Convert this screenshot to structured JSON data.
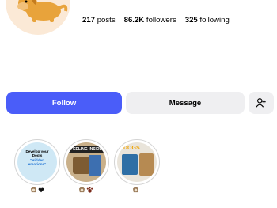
{
  "profile": {
    "avatar_icon": "dog-avatar",
    "stats": [
      {
        "value": "217",
        "label": "posts"
      },
      {
        "value": "86.2K",
        "label": "followers"
      },
      {
        "value": "325",
        "label": "following"
      }
    ]
  },
  "actions": {
    "follow_label": "Follow",
    "message_label": "Message",
    "add_user_icon": "add-user-icon"
  },
  "highlights": [
    {
      "text_lines": [
        "Develop your",
        "Dog's",
        "\"Hidden",
        "emotions\""
      ],
      "label_icons": [
        "dog-emoji",
        "heart-emoji"
      ]
    },
    {
      "banner": "FEELING INSIDE",
      "label_icons": [
        "dog-emoji",
        "paw-emoji"
      ]
    },
    {
      "banner": "DOGS",
      "label_icons": [
        "dog-emoji"
      ]
    }
  ],
  "colors": {
    "accent": "#4a5df9",
    "secondary_button": "#efeff1",
    "highlight_ring": "#d4d4d4"
  }
}
